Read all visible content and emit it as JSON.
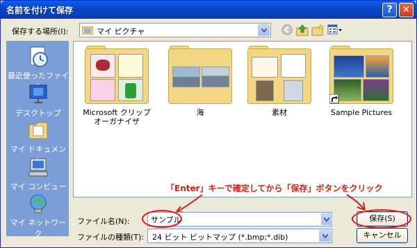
{
  "window": {
    "title": "名前を付けて保存",
    "help_glyph": "?",
    "close_glyph": "✕"
  },
  "save_in": {
    "label": "保存する場所(I):",
    "value": "マイ ピクチャ"
  },
  "places": [
    {
      "label": "最近使ったファイル",
      "icon": "recent-documents-icon"
    },
    {
      "label": "デスクトップ",
      "icon": "desktop-icon"
    },
    {
      "label": "マイ ドキュメント",
      "icon": "my-documents-icon"
    },
    {
      "label": "マイ コンピュータ",
      "icon": "my-computer-icon"
    },
    {
      "label": "マイ ネットワーク",
      "icon": "my-network-icon"
    }
  ],
  "items": [
    {
      "label": "Microsoft クリップ オーガナイザ",
      "icon": "folder-icon"
    },
    {
      "label": "海",
      "icon": "folder-icon"
    },
    {
      "label": "素材",
      "icon": "folder-icon"
    },
    {
      "label": "Sample Pictures",
      "icon": "folder-shortcut-icon"
    }
  ],
  "file_name": {
    "label": "ファイル名(N):",
    "value": "サンプル"
  },
  "file_type": {
    "label": "ファイルの種類(T):",
    "value": "24 ビット ビットマップ (*.bmp;*.dib)"
  },
  "buttons": {
    "save": "保存(S)",
    "cancel": "キャンセル"
  },
  "annotation": "「Enter」キーで確定してから「保存」ボタンをクリック",
  "colors": {
    "title_bar": "#0a5fe6",
    "places_bar": "#7b9ed6",
    "annotation": "#d91c16"
  }
}
